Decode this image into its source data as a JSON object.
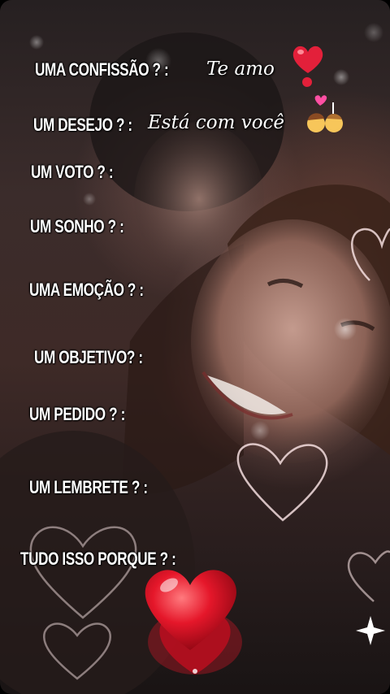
{
  "lines": [
    {
      "label": "UMA CONFISSÃO ? :",
      "answer": "Te amo"
    },
    {
      "label": "UM DESEJO ? :",
      "answer": "Está com você"
    },
    {
      "label": "UM VOTO ? :"
    },
    {
      "label": "UM SONHO ? :"
    },
    {
      "label": "UMA EMOÇÃO ? :"
    },
    {
      "label": "UM OBJETIVO? :"
    },
    {
      "label": "UM PEDIDO ? :"
    },
    {
      "label": "UM LEMBRETE ? :"
    },
    {
      "label": "TUDO ISSO PORQUE ? :"
    }
  ],
  "icons": [
    "heart-exclamation-icon",
    "kissing-couple-icon",
    "big-red-heart-icon",
    "sparkle-icon",
    "heart-outline-icon"
  ],
  "colors": {
    "heart_red": "#e01828",
    "text": "#ffffff"
  }
}
